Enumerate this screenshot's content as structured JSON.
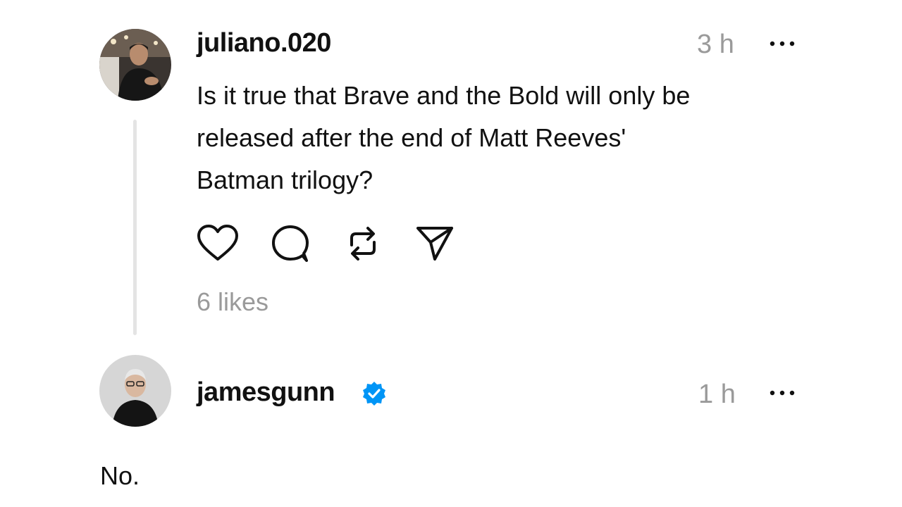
{
  "thread": {
    "post": {
      "username": "juliano.020",
      "time": "3 h",
      "text_lines": [
        "Is it true that Brave and the Bold will only be",
        "released after the end of Matt Reeves'",
        "Batman trilogy?"
      ],
      "likes": "6 likes",
      "actions": [
        "heart-icon",
        "comment-icon",
        "repost-icon",
        "share-icon"
      ]
    },
    "reply": {
      "username": "jamesgunn",
      "verified": true,
      "time": "1 h",
      "text": "No."
    }
  },
  "colors": {
    "text": "#111111",
    "muted": "#9a9a9a",
    "thread_line": "#e4e4e4",
    "verified_badge": "#0095f6"
  }
}
